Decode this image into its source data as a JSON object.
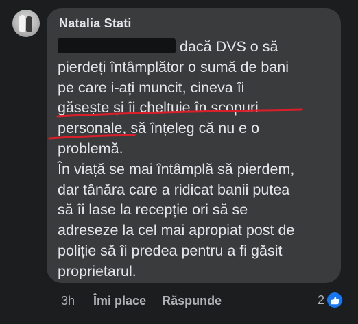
{
  "comment": {
    "author": "Natalia  Stati",
    "lines": [
      "dacă DVS o să",
      "pierdeți întâmplător o sumă de bani",
      "pe care i-ați muncit, cineva îi",
      "găsește și îi cheltuie în scopuri",
      "personale, să înțeleg că nu e o",
      "problemă.",
      "În viață se mai întâmplă să pierdem,",
      "dar tânăra care a ridicat banii putea",
      "să îi lase la recepție ori să se",
      "adreseze la cel mai apropiat post de",
      "poliție să îi predea pentru a fi găsit",
      "proprietarul."
    ]
  },
  "actions": {
    "time": "3h",
    "like_label": "Îmi place",
    "reply_label": "Răspunde",
    "reaction_count": "2"
  },
  "colors": {
    "bubble": "#3a3b3c",
    "text": "#e4e6eb",
    "underline": "#d81f2a",
    "like": "#1877f2"
  }
}
